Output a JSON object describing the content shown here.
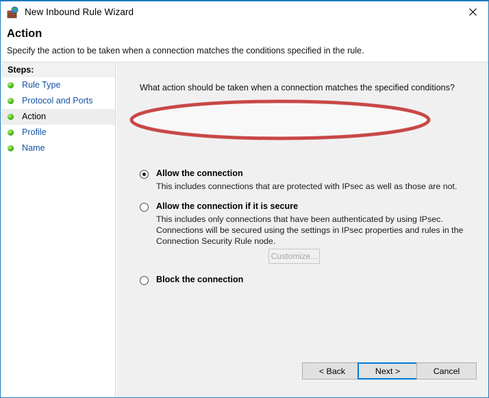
{
  "window": {
    "title": "New Inbound Rule Wizard",
    "icon": "firewall-globe-icon",
    "close_label": "✕",
    "accent_color": "#1a7bbf"
  },
  "header": {
    "title": "Action",
    "subtitle": "Specify the action to be taken when a connection matches the conditions specified in the rule."
  },
  "sidebar": {
    "header": "Steps:",
    "items": [
      {
        "label": "Rule Type",
        "state": "link"
      },
      {
        "label": "Protocol and Ports",
        "state": "link"
      },
      {
        "label": "Action",
        "state": "current"
      },
      {
        "label": "Profile",
        "state": "link"
      },
      {
        "label": "Name",
        "state": "link"
      }
    ]
  },
  "main": {
    "question": "What action should be taken when a connection matches the specified conditions?",
    "options": [
      {
        "id": "allow",
        "title": "Allow the connection",
        "description": "This includes connections that are protected with IPsec as well as those are not.",
        "selected": true
      },
      {
        "id": "allow-if-secure",
        "title": "Allow the connection if it is secure",
        "description": "This includes only connections that have been authenticated by using IPsec.  Connections will be secured using the settings in IPsec properties and rules in the Connection Security Rule node.",
        "selected": false
      },
      {
        "id": "block",
        "title": "Block the connection",
        "description": "",
        "selected": false
      }
    ],
    "customize_label": "Customize...",
    "customize_disabled": true
  },
  "annotation": {
    "shape": "ellipse",
    "color": "#cc4444",
    "target": "Allow the connection"
  },
  "footer": {
    "back_label": "< Back",
    "next_label": "Next >",
    "cancel_label": "Cancel",
    "focused_button": "Next >"
  }
}
